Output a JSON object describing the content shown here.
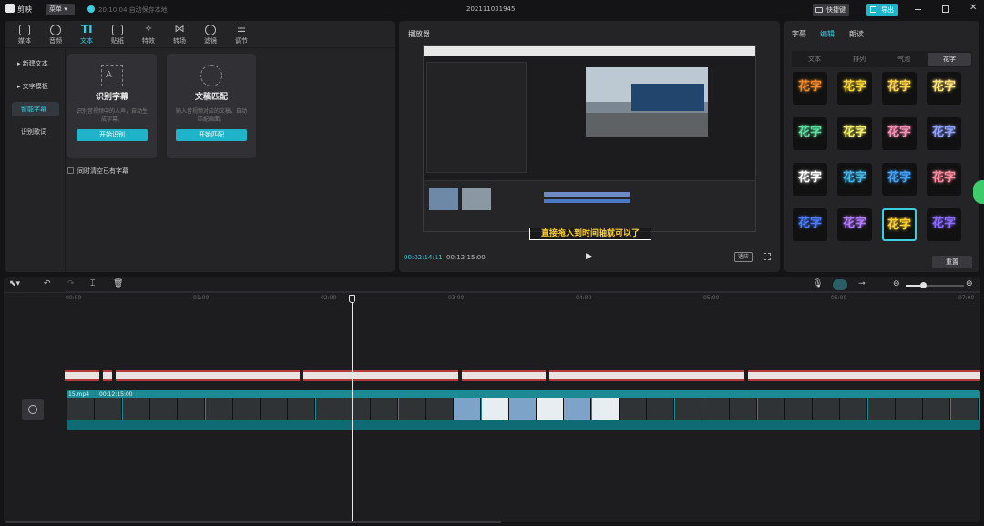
{
  "app": {
    "name": "剪映",
    "menu_label": "菜单",
    "autosave": "20:10:04 自动保存本地",
    "project_title": "202111031945",
    "shortcut_label": "快捷键",
    "export_label": "导出"
  },
  "toolbar": {
    "items": [
      {
        "label": "媒体",
        "icon": "media-icon"
      },
      {
        "label": "音频",
        "icon": "audio-icon"
      },
      {
        "label": "文本",
        "icon": "text-icon",
        "active": true
      },
      {
        "label": "贴纸",
        "icon": "sticker-icon"
      },
      {
        "label": "特效",
        "icon": "effects-icon"
      },
      {
        "label": "转场",
        "icon": "transition-icon"
      },
      {
        "label": "滤镜",
        "icon": "filter-icon"
      },
      {
        "label": "调节",
        "icon": "adjust-icon"
      }
    ]
  },
  "text_sidebar": {
    "items": [
      "新建文本",
      "文字模板",
      "智能字幕",
      "识别歌词"
    ],
    "active": "智能字幕"
  },
  "cards": [
    {
      "title": "识别字幕",
      "desc": "识别音视频中的人声，自动生成字幕。",
      "button": "开始识别"
    },
    {
      "title": "文稿匹配",
      "desc": "输入音视频对应的文稿，自动匹配画面。",
      "button": "开始匹配"
    }
  ],
  "clear_checkbox": "同时清空已有字幕",
  "player": {
    "title": "播放器",
    "current_time": "00:02:14:11",
    "total_time": "00:12:15:00",
    "fit_label": "适应",
    "caption": "直接拖入到时间轴就可以了"
  },
  "right_panel": {
    "tabs": [
      "字幕",
      "编辑",
      "朗读"
    ],
    "active_tab": "编辑",
    "subtabs": [
      "文本",
      "排列",
      "气泡",
      "花字"
    ],
    "active_subtab": "花字",
    "tile_label": "花字",
    "tile_colors": [
      "#f08a2a",
      "#f7d33a",
      "#ffd44a",
      "#ffe27a",
      "#5fe0a0",
      "#f1ef6e",
      "#ff8fb6",
      "#8fa2ff",
      "#ffffff",
      "#45b7e8",
      "#3fa3ff",
      "#ff8a9e",
      "#4b7cff",
      "#b37bff",
      "#ffcf2e",
      "#8a6bff"
    ],
    "reset_label": "重置"
  },
  "timeline": {
    "ticks": [
      "00:00",
      "01:00",
      "02:00",
      "03:00",
      "04:00",
      "05:00",
      "06:00",
      "07:00"
    ],
    "clip_name": "15.mp4",
    "clip_duration": "00:12:15:00"
  },
  "colors": {
    "accent": "#3ccde0",
    "panel": "#242427",
    "export": "#1fb4c9"
  }
}
